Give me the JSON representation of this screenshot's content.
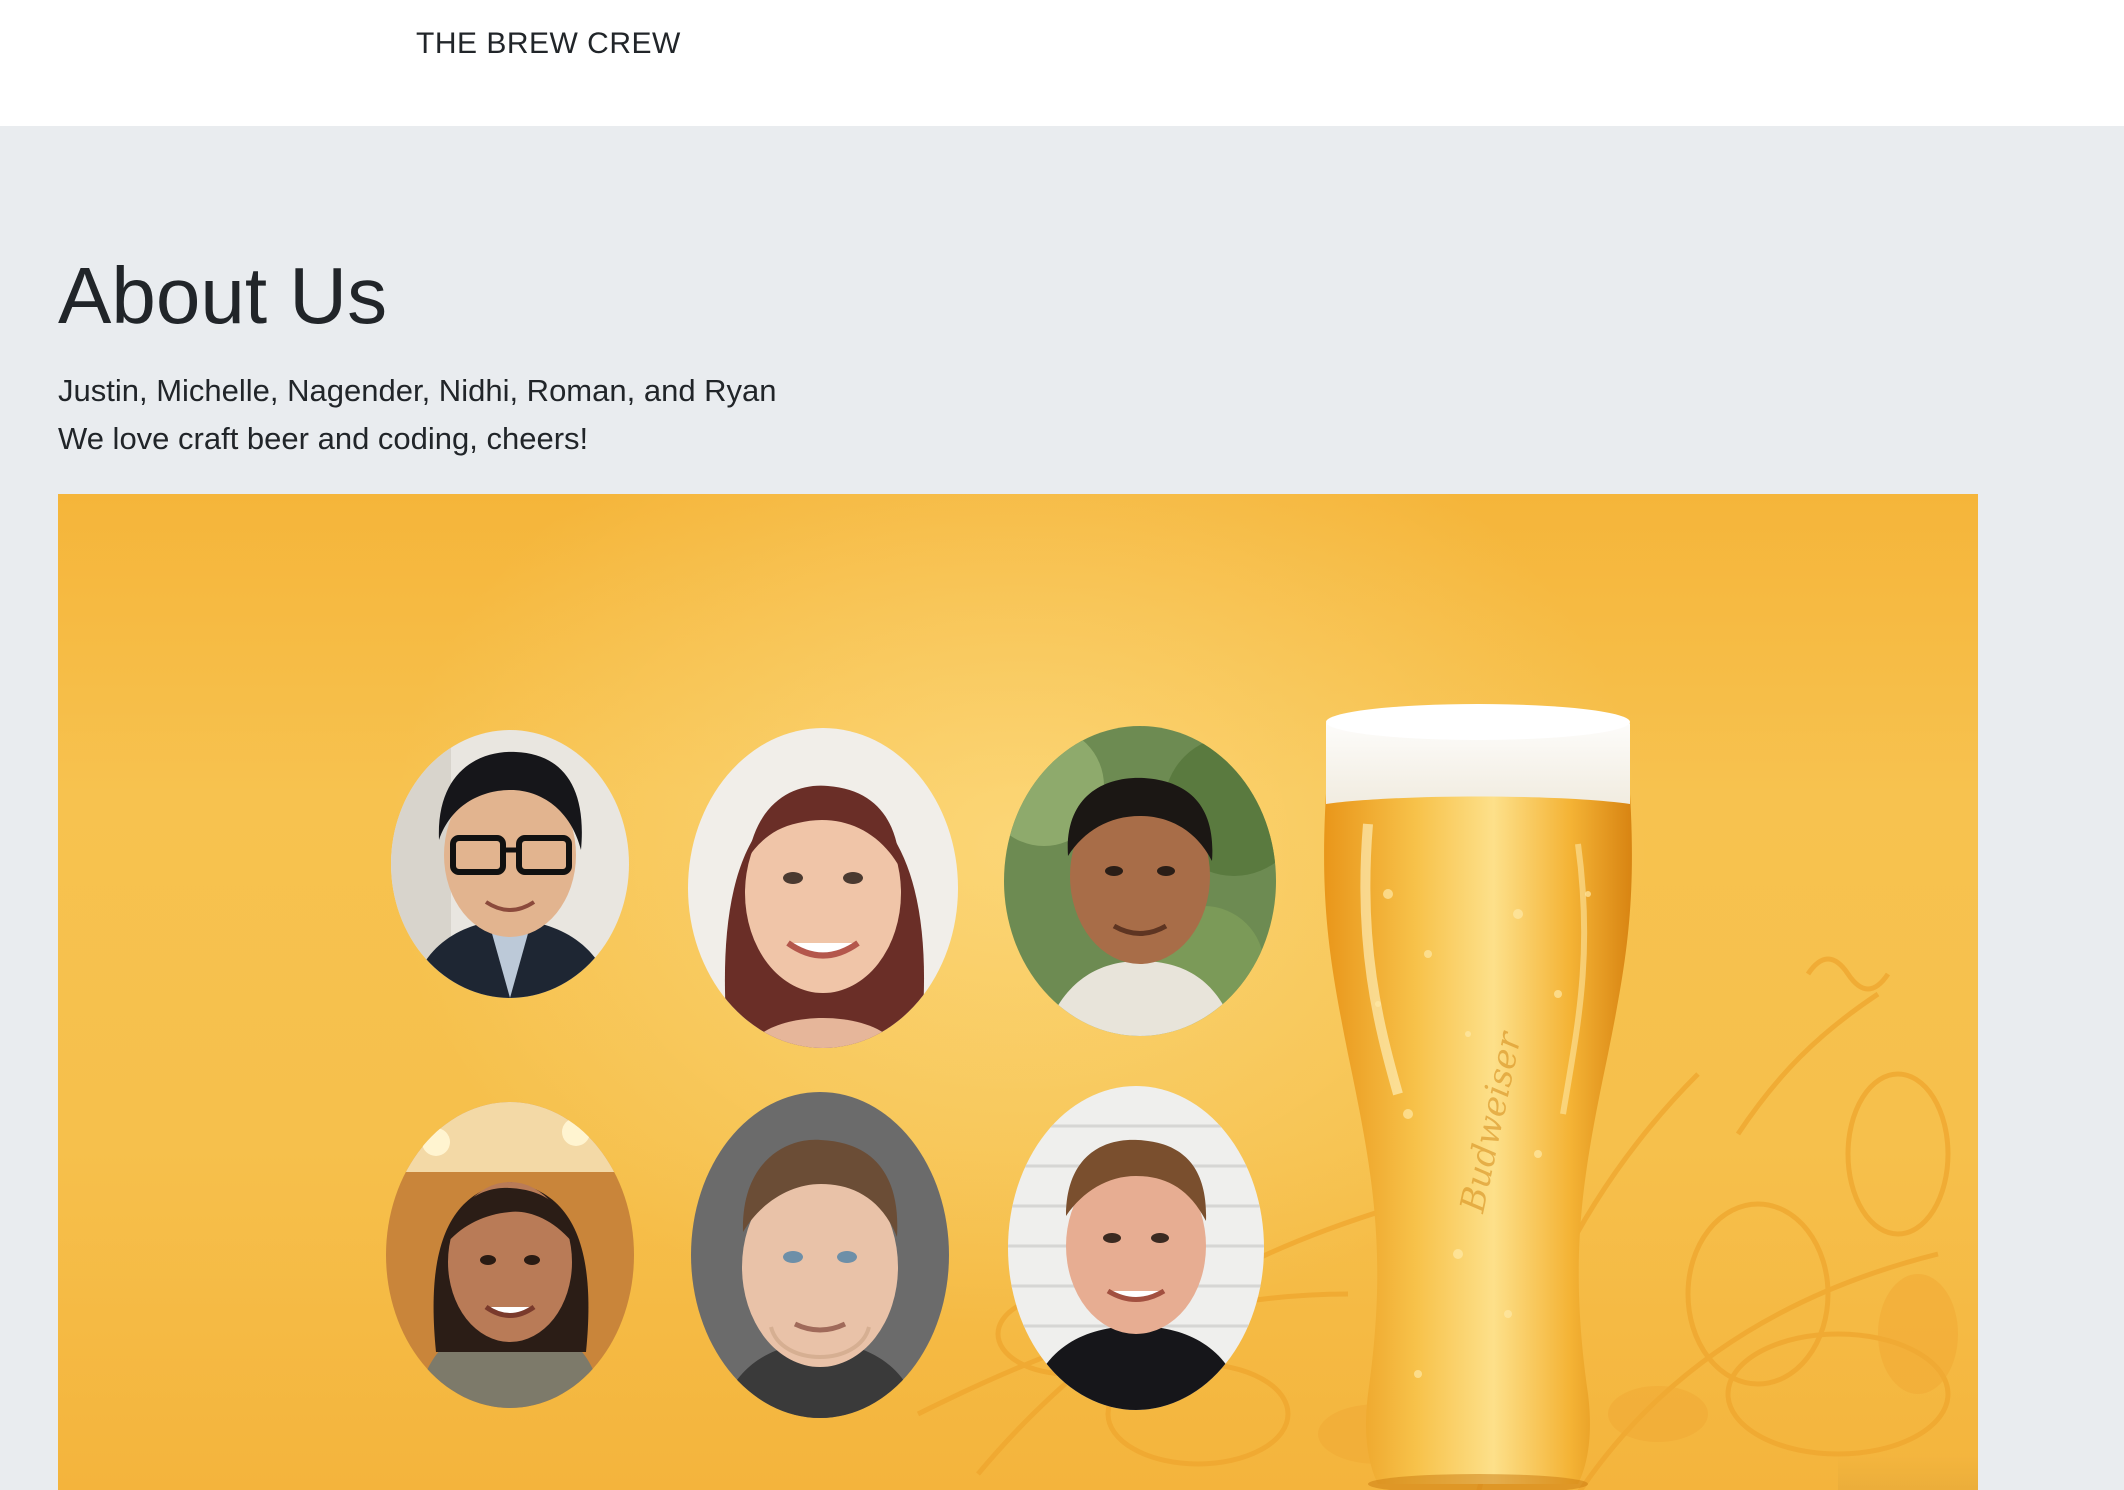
{
  "navbar": {
    "brand": "THE BREW CREW"
  },
  "about": {
    "title": "About Us",
    "names_line": "Justin, Michelle, Nagender, Nidhi, Roman, and Ryan",
    "tagline": "We love craft beer and coding, cheers!"
  },
  "banner": {
    "glass_brand_text": "Budweiser",
    "team": [
      {
        "name": "Justin"
      },
      {
        "name": "Michelle"
      },
      {
        "name": "Nagender"
      },
      {
        "name": "Nidhi"
      },
      {
        "name": "Roman"
      },
      {
        "name": "Ryan"
      }
    ]
  },
  "colors": {
    "page_bg": "#e9ecef",
    "navbar_bg": "#ffffff",
    "text": "#212529",
    "banner_gold": "#f6bd47"
  }
}
